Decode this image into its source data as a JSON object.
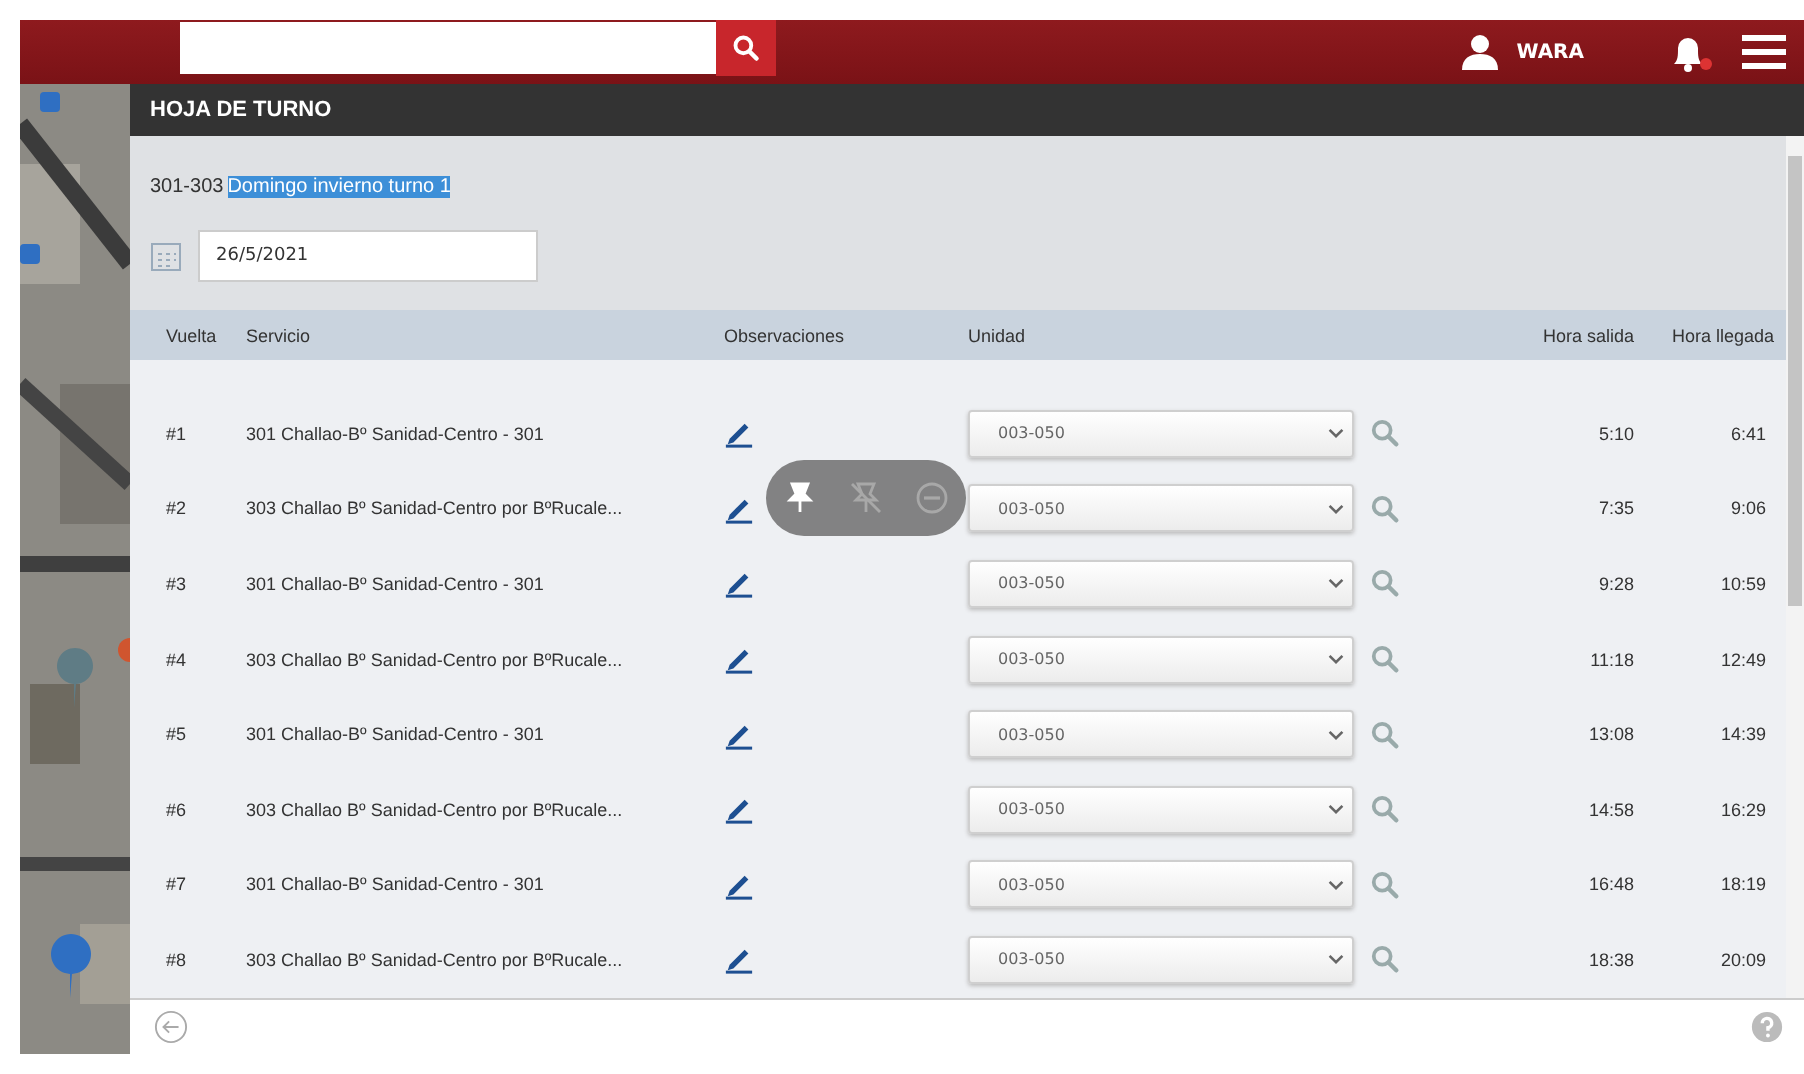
{
  "top_bar": {
    "user": "WARA"
  },
  "window": {
    "title": "HOJA DE TURNO"
  },
  "schedule": {
    "code": "301-303",
    "name": "Domingo invierno turno 1",
    "name_highlighted": true
  },
  "date_field": {
    "value": "26/5/2021"
  },
  "floating_toolbar": [
    {
      "kind": "pin",
      "disabled": false
    },
    {
      "kind": "unpin",
      "disabled": true
    },
    {
      "kind": "minus",
      "disabled": true
    }
  ],
  "table": {
    "columns": [
      "Vuelta",
      "Servicio",
      "Observaciones",
      "Unidad",
      "Hora salida",
      "Hora llegada"
    ],
    "rows": [
      {
        "vuelta": "#1",
        "servicio": "301 Challao-Bº Sanidad-Centro - 301",
        "unidad": "003-050",
        "salida": "5:10",
        "llegada": "6:41"
      },
      {
        "vuelta": "#2",
        "servicio": "303 Challao Bº Sanidad-Centro por BºRucale...",
        "unidad": "003-050",
        "salida": "7:35",
        "llegada": "9:06"
      },
      {
        "vuelta": "#3",
        "servicio": "301 Challao-Bº Sanidad-Centro - 301",
        "unidad": "003-050",
        "salida": "9:28",
        "llegada": "10:59"
      },
      {
        "vuelta": "#4",
        "servicio": "303 Challao Bº Sanidad-Centro por BºRucale...",
        "unidad": "003-050",
        "salida": "11:18",
        "llegada": "12:49"
      },
      {
        "vuelta": "#5",
        "servicio": "301 Challao-Bº Sanidad-Centro - 301",
        "unidad": "003-050",
        "salida": "13:08",
        "llegada": "14:39"
      },
      {
        "vuelta": "#6",
        "servicio": "303 Challao Bº Sanidad-Centro por BºRucale...",
        "unidad": "003-050",
        "salida": "14:58",
        "llegada": "16:29"
      },
      {
        "vuelta": "#7",
        "servicio": "301 Challao-Bº Sanidad-Centro - 301",
        "unidad": "003-050",
        "salida": "16:48",
        "llegada": "18:19"
      },
      {
        "vuelta": "#8",
        "servicio": "303 Challao Bº Sanidad-Centro por BºRucale...",
        "unidad": "003-050",
        "salida": "18:38",
        "llegada": "20:09"
      }
    ]
  }
}
